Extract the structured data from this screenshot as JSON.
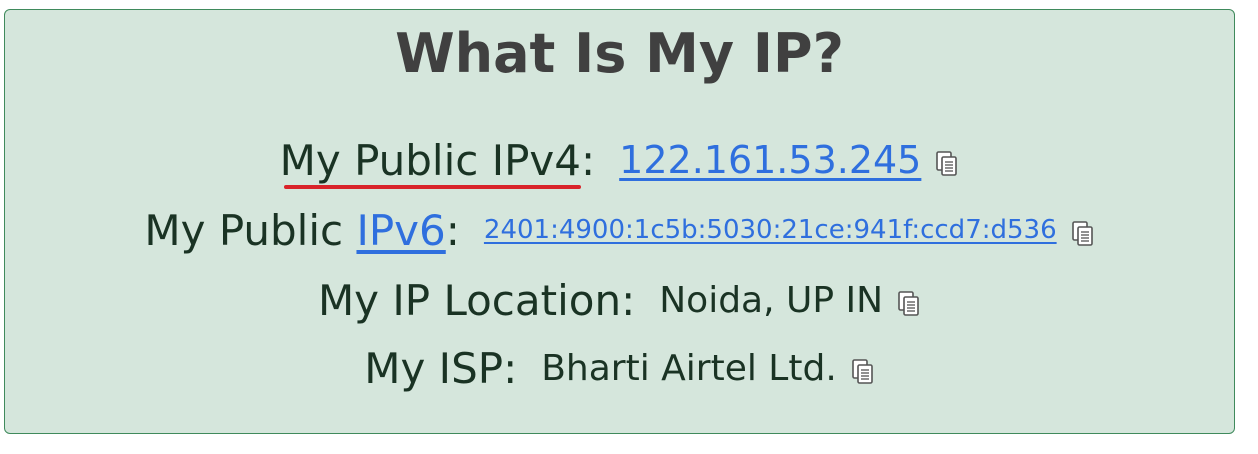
{
  "title": "What Is My IP?",
  "rows": {
    "ipv4": {
      "label": "My Public IPv4",
      "colon": ":",
      "value": "122.161.53.245"
    },
    "ipv6": {
      "label_prefix": "My Public ",
      "label_link": "IPv6",
      "colon": ":",
      "value": "2401:4900:1c5b:5030:21ce:941f:ccd7:d536"
    },
    "location": {
      "label": "My IP Location",
      "colon": ":",
      "value": "Noida, UP IN"
    },
    "isp": {
      "label": "My ISP",
      "colon": ":",
      "value": "Bharti Airtel Ltd."
    }
  },
  "icons": {
    "copy": "copy-icon"
  },
  "colors": {
    "panel_bg": "#d5e6dc",
    "panel_border": "#3f8a5c",
    "link": "#2f6fde",
    "text": "#1a3324",
    "title": "#404040",
    "highlight_underline": "#d9232a"
  }
}
